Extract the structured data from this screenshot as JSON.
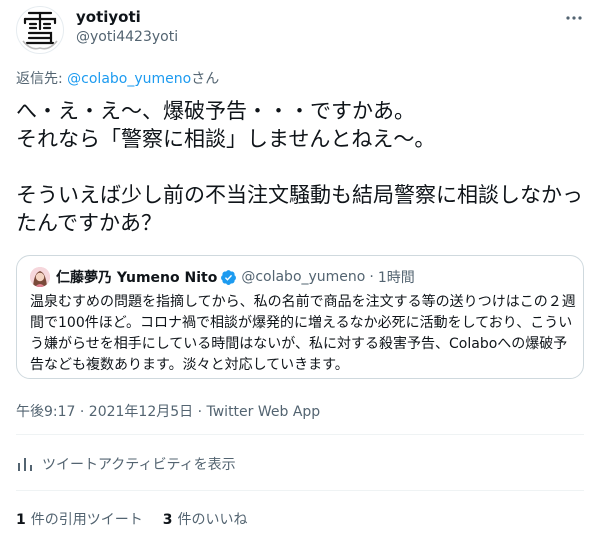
{
  "author": {
    "name": "yotiyoti",
    "handle": "@yoti4423yoti"
  },
  "reply": {
    "prefix": "返信先: ",
    "mention": "@colabo_yumeno",
    "suffix": "さん"
  },
  "tweet": {
    "text": "へ・え・え〜、爆破予告・・・ですかあ。\nそれなら「警察に相談」しませんとねえ〜。\n\nそういえば少し前の不当注文騒動も結局警察に相談しなかったんですかあ？"
  },
  "quote": {
    "name": "仁藤夢乃 Yumeno Nito",
    "handle": "@colabo_yumeno",
    "separator": "·",
    "time": "1時間",
    "text": "温泉むすめの問題を指摘してから、私の名前で商品を注文する等の送りつけはこの２週間で100件ほど。コロナ禍で相談が爆発的に増えるなか必死に活動をしており、こういう嫌がらせを相手にしている時間はないが、私に対する殺害予告、Colaboへの爆破予告なども複数あります。淡々と対応していきます。"
  },
  "meta": {
    "timestamp": "午後9:17 · 2021年12月5日 · Twitter Web App"
  },
  "activity": {
    "label": "ツイートアクティビティを表示",
    "icon": "bar-chart-icon"
  },
  "stats": {
    "quote_count": "1",
    "quote_label": "件の引用ツイート",
    "like_count": "3",
    "like_label": "件のいいね"
  },
  "colors": {
    "link": "#1d9bf0",
    "secondary": "#536471",
    "primary": "#0f1419",
    "border": "#cfd9de"
  }
}
